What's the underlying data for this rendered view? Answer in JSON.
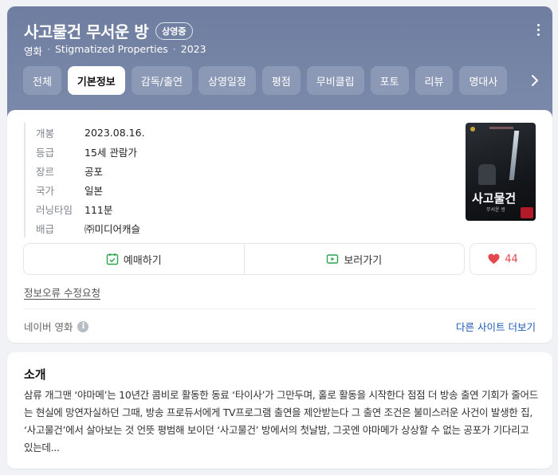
{
  "header": {
    "title": "사고물건 무서운 방",
    "badge": "상영중",
    "meta": [
      "영화",
      "Stigmatized Properties",
      "2023"
    ],
    "more_icon": "kebab-menu-icon",
    "colors": {
      "header_bg": "#7584a5",
      "tab_bg": "#8c99b6"
    }
  },
  "tabs": [
    {
      "label": "전체",
      "active": false
    },
    {
      "label": "기본정보",
      "active": true
    },
    {
      "label": "감독/출연",
      "active": false
    },
    {
      "label": "상영일정",
      "active": false
    },
    {
      "label": "평점",
      "active": false
    },
    {
      "label": "무비클립",
      "active": false
    },
    {
      "label": "포토",
      "active": false
    },
    {
      "label": "리뷰",
      "active": false
    },
    {
      "label": "명대사",
      "active": false
    }
  ],
  "info": [
    {
      "label": "개봉",
      "value": "2023.08.16."
    },
    {
      "label": "등급",
      "value": "15세 관람가"
    },
    {
      "label": "장르",
      "value": "공포"
    },
    {
      "label": "국가",
      "value": "일본"
    },
    {
      "label": "러닝타임",
      "value": "111분"
    },
    {
      "label": "배급",
      "value": "㈜미디어캐슬"
    }
  ],
  "poster": {
    "title": "사고물건",
    "subtitle": "무서운 방"
  },
  "actions": {
    "reserve": "예매하기",
    "watch": "보러가기",
    "likes": "44"
  },
  "report_link": "정보오류 수정요청",
  "source": {
    "label": "네이버 영화",
    "more": "다른 사이트 더보기"
  },
  "intro": {
    "title": "소개",
    "text": "삼류 개그맨 ‘야마메’는 10년간 콤비로 활동한 동료 ‘타이사’가 그만두며, 홀로 활동을 시작한다 점점 더 방송 출연 기회가 줄어드는 현실에 망연자실하던 그때, 방송 프로듀서에게 TV프로그램 출연을 제안받는다 그 출연 조건은 불미스러운 사건이 발생한 집, ‘사고물건’에서 살아보는 것 언뜻 평범해 보이던 ‘사고물건’ 방에서의 첫날밤, 그곳엔 야마메가 상상할 수 없는 공포가 기다리고 있는데..."
  }
}
